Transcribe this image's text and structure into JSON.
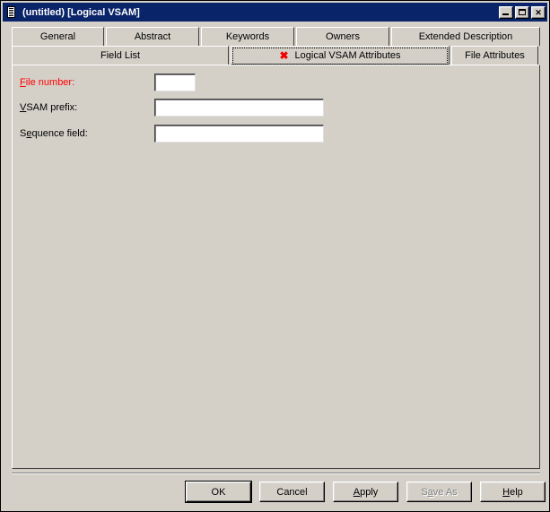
{
  "window": {
    "title": "(untitled) [Logical VSAM]",
    "icon": "document-icon",
    "controls": {
      "minimize": "_",
      "maximize": "□",
      "close": "✕"
    },
    "colors": {
      "titlebar": "#0a246a",
      "face": "#d4d0c8",
      "required_label": "#ff0000",
      "error_marker": "#ee0000"
    }
  },
  "tabs": {
    "row1": [
      {
        "label": "General",
        "active": false
      },
      {
        "label": "Abstract",
        "active": false
      },
      {
        "label": "Keywords",
        "active": false
      },
      {
        "label": "Owners",
        "active": false
      },
      {
        "label": "Extended Description",
        "active": false
      }
    ],
    "row2": [
      {
        "label": "Field List",
        "active": false,
        "marker": ""
      },
      {
        "label": "Logical VSAM Attributes",
        "active": true,
        "marker": "✖"
      },
      {
        "label": "File Attributes",
        "active": false,
        "marker": ""
      }
    ]
  },
  "form": {
    "fields": [
      {
        "label_before": "",
        "accel": "F",
        "label_after": "ile number:",
        "required": true,
        "value": "",
        "placeholder": ""
      },
      {
        "label_before": "",
        "accel": "V",
        "label_after": "SAM prefix:",
        "required": false,
        "value": "",
        "placeholder": ""
      },
      {
        "label_before": "S",
        "accel": "e",
        "label_after": "quence field:",
        "required": false,
        "value": "",
        "placeholder": ""
      }
    ]
  },
  "buttons": [
    {
      "before": "OK",
      "accel": "",
      "after": "",
      "default": true,
      "disabled": false
    },
    {
      "before": "Cancel",
      "accel": "",
      "after": "",
      "default": false,
      "disabled": false
    },
    {
      "before": "",
      "accel": "A",
      "after": "pply",
      "default": false,
      "disabled": false
    },
    {
      "before": "S",
      "accel": "a",
      "after": "ve As",
      "default": false,
      "disabled": true
    },
    {
      "before": "",
      "accel": "H",
      "after": "elp",
      "default": false,
      "disabled": false
    }
  ]
}
